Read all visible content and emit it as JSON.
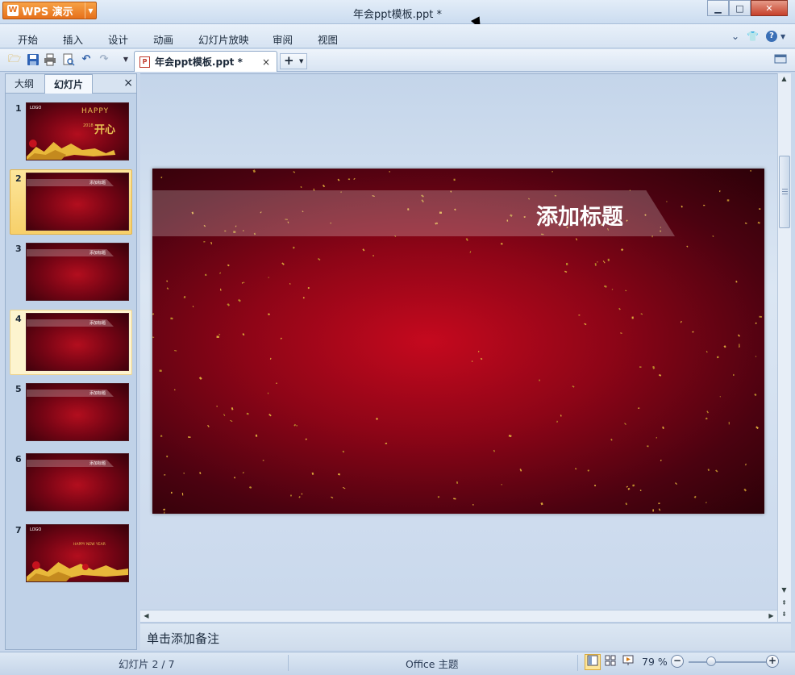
{
  "app": {
    "brand_label": "WPS 演示",
    "window_title": "年会ppt模板.ppt *",
    "window_controls": {
      "minimize": "▁",
      "maximize": "□",
      "close": "✕"
    }
  },
  "menubar": {
    "items": [
      "开始",
      "插入",
      "设计",
      "动画",
      "幻灯片放映",
      "审阅",
      "视图"
    ],
    "right_icons": [
      "chevron-down-icon",
      "shirt-icon",
      "help-icon"
    ]
  },
  "toolbar": {
    "icons": [
      "open-folder-icon",
      "save-icon",
      "print-icon",
      "print-preview-icon",
      "undo-icon",
      "redo-icon",
      "customize-icon"
    ],
    "document_tab": {
      "label": "年会ppt模板.ppt *",
      "close": "×"
    },
    "new_tab": "+"
  },
  "left_pane": {
    "tabs": [
      "大纲",
      "幻灯片"
    ],
    "active_tab": "幻灯片",
    "close": "×",
    "slides": [
      {
        "number": "1",
        "type": "cover",
        "logo": "LOGO",
        "happy": "HAPPY",
        "kai": "开心",
        "year": "2018"
      },
      {
        "number": "2",
        "type": "title",
        "label": "添加标题",
        "state": "selected"
      },
      {
        "number": "3",
        "type": "title",
        "label": "添加标题"
      },
      {
        "number": "4",
        "type": "title",
        "label": "添加标题",
        "state": "hover"
      },
      {
        "number": "5",
        "type": "title",
        "label": "添加标题"
      },
      {
        "number": "6",
        "type": "title",
        "label": "添加标题"
      },
      {
        "number": "7",
        "type": "ending",
        "logo": "LOGO",
        "hny": "HAPPY NEW YEAR"
      }
    ]
  },
  "slide": {
    "title": "添加标题"
  },
  "notes": {
    "placeholder": "单击添加备注"
  },
  "status": {
    "slide_indicator": "幻灯片 2 / 7",
    "theme": "Office 主题",
    "zoom": "79 %",
    "zoom_level": 0.79
  },
  "colors": {
    "accent_orange": "#e6701b",
    "slide_red": "#c5091e",
    "gold": "#e8c052"
  }
}
